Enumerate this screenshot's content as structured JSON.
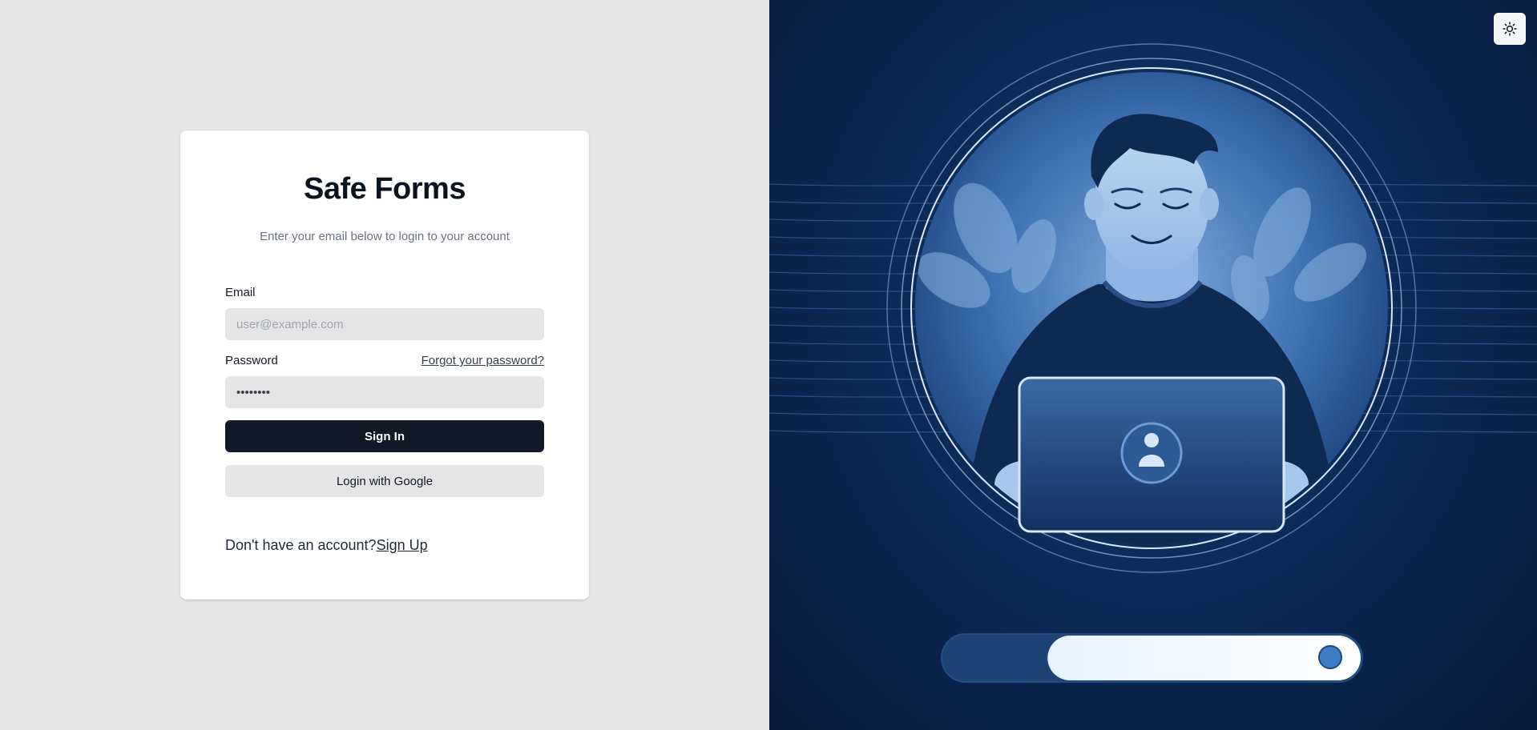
{
  "app": {
    "title": "Safe Forms",
    "subtitle": "Enter your email below to login to your account"
  },
  "form": {
    "email_label": "Email",
    "email_placeholder": "user@example.com",
    "password_label": "Password",
    "password_value": "••••••••",
    "forgot_link": "Forgot your password?",
    "sign_in_label": "Sign In",
    "google_label": "Login with Google",
    "no_account_text": "Don't have an account?",
    "sign_up_link": "Sign Up"
  },
  "icons": {
    "theme_toggle": "sun-icon",
    "laptop_badge": "user-icon"
  },
  "colors": {
    "primary_button": "#111827",
    "illustration_bg": "#0d2a57",
    "accent": "#3f7cc4"
  },
  "illustration": {
    "progress_fraction": 0.75
  }
}
